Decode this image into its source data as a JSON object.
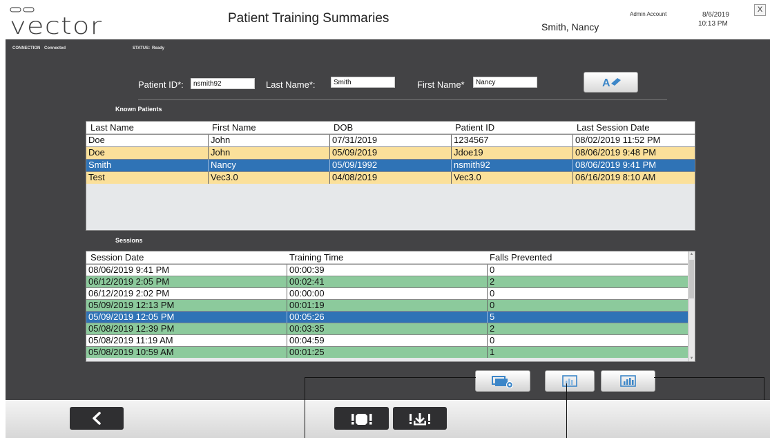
{
  "header": {
    "logo_text": "vector",
    "title": "Patient Training Summaries",
    "user_name": "Smith, Nancy",
    "account_label": "Admin Account",
    "date": "8/6/2019",
    "time": "10:13 PM",
    "close_label": "X"
  },
  "status": {
    "connection_label": "CONNECTION",
    "connection_value": "Connected",
    "status_label": "STATUS:",
    "status_value": "Ready"
  },
  "form": {
    "patient_id_label": "Patient ID*:",
    "patient_id_value": "nsmith92",
    "last_name_label": "Last Name*:",
    "last_name_value": "Smith",
    "first_name_label": "First Name*",
    "first_name_value": "Nancy",
    "edit_button_icon": "edit-name-icon"
  },
  "known_patients": {
    "section_label": "Known Patients",
    "columns": [
      "Last Name",
      "First Name",
      "DOB",
      "Patient ID",
      "Last Session Date"
    ],
    "rows": [
      {
        "last": "Doe",
        "first": "John",
        "dob": "07/31/2019",
        "pid": "1234567",
        "last_session": "08/02/2019 11:52 PM",
        "style": "white"
      },
      {
        "last": "Doe",
        "first": "John",
        "dob": "05/09/2019",
        "pid": "Jdoe19",
        "last_session": "08/06/2019 9:48 PM",
        "style": "yellow"
      },
      {
        "last": "Smith",
        "first": "Nancy",
        "dob": "05/09/1992",
        "pid": "nsmith92",
        "last_session": "08/06/2019 9:41 PM",
        "style": "selected"
      },
      {
        "last": "Test",
        "first": "Vec3.0",
        "dob": "04/08/2019",
        "pid": "Vec3.0",
        "last_session": "06/16/2019 8:10 AM",
        "style": "yellow"
      }
    ]
  },
  "sessions": {
    "section_label": "Sessions",
    "columns": [
      "Session Date",
      "Training Time",
      "Falls Prevented"
    ],
    "rows": [
      {
        "date": "08/06/2019 9:41 PM",
        "time": "00:00:39",
        "falls": "0",
        "style": "white"
      },
      {
        "date": "06/12/2019 2:05 PM",
        "time": "00:02:41",
        "falls": "2",
        "style": "green"
      },
      {
        "date": "06/12/2019 2:02 PM",
        "time": "00:00:00",
        "falls": "0",
        "style": "white"
      },
      {
        "date": "05/09/2019 12:13 PM",
        "time": "00:01:19",
        "falls": "0",
        "style": "green"
      },
      {
        "date": "05/09/2019 12:05 PM",
        "time": "00:05:26",
        "falls": "5",
        "style": "selected"
      },
      {
        "date": "05/08/2019 12:39 PM",
        "time": "00:03:35",
        "falls": "2",
        "style": "green"
      },
      {
        "date": "05/08/2019 11:19 AM",
        "time": "00:04:59",
        "falls": "0",
        "style": "white"
      },
      {
        "date": "05/08/2019 10:59 AM",
        "time": "00:01:25",
        "falls": "1",
        "style": "green"
      }
    ]
  },
  "actions": {
    "view_session_icon": "view-session-icon",
    "session_report_icon": "session-report-icon",
    "summary_report_icon": "summary-report-icon"
  },
  "footer": {
    "back_icon": "back-arrow-icon",
    "alert_icon": "alert-icon",
    "hardware_alert_icon": "hardware-alert-icon"
  },
  "colors": {
    "dark_panel": "#434345",
    "row_yellow": "#fbe09a",
    "row_green": "#8cca9c",
    "row_selected": "#2f73b6",
    "button_icon_blue": "#3c86c8"
  }
}
